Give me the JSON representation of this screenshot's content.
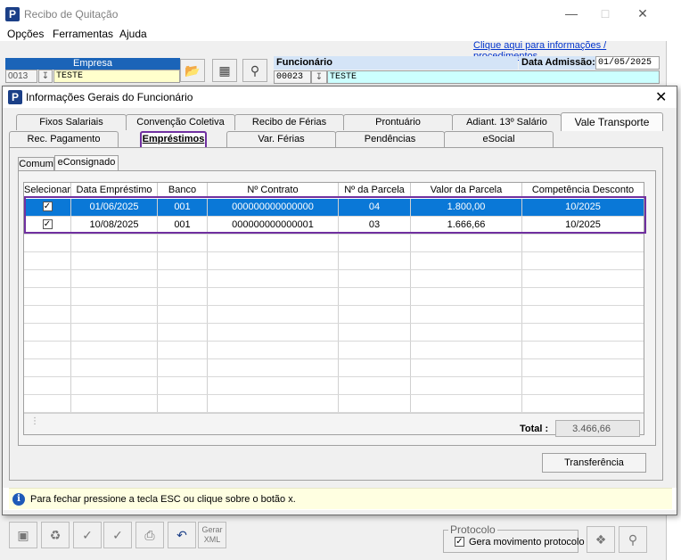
{
  "main_window": {
    "title": "Recibo de Quitação",
    "menu": [
      "Opções",
      "Ferramentas",
      "Ajuda"
    ],
    "info_link": "Clique aqui para informações / procedimentos",
    "empresa": {
      "label": "Empresa",
      "code": "0013",
      "name": "TESTE"
    },
    "funcionario": {
      "label": "Funcionário",
      "code": "00023",
      "name": "TESTE"
    },
    "data_admissao": {
      "label": "Data Admissão:",
      "value": "01/05/2025"
    },
    "bottom": {
      "gerar_xml": "Gerar\nXML",
      "protocolo_label": "Protocolo",
      "gera_movimento": "Gera movimento protocolo"
    }
  },
  "dialog": {
    "title": "Informações Gerais do Funcionário",
    "tabs_row1": [
      "Fixos Salariais",
      "Convenção Coletiva",
      "Recibo de Férias",
      "Prontuário",
      "Adiant. 13º Salário",
      "Vale Transporte"
    ],
    "tabs_row2": [
      "Rec. Pagamento",
      "Empréstimos",
      "Var. Férias",
      "Pendências",
      "eSocial"
    ],
    "active_tab": "Empréstimos",
    "subtabs": [
      "Comum",
      "eConsignado"
    ],
    "active_subtab": "eConsignado",
    "grid": {
      "columns": [
        "Selecionar",
        "Data Empréstimo",
        "Banco",
        "Nº Contrato",
        "Nº da Parcela",
        "Valor da Parcela",
        "Competência Desconto"
      ],
      "rows": [
        {
          "selected": true,
          "data": "01/06/2025",
          "banco": "001",
          "contrato": "000000000000000",
          "parcela": "04",
          "valor": "1.800,00",
          "competencia": "10/2025"
        },
        {
          "selected": true,
          "data": "10/08/2025",
          "banco": "001",
          "contrato": "000000000000001",
          "parcela": "03",
          "valor": "1.666,66",
          "competencia": "10/2025"
        }
      ]
    },
    "total_label": "Total :",
    "total_value": "3.466,66",
    "transfer_button": "Transferência",
    "info_message": "Para fechar pressione a tecla ESC ou clique sobre o botão x.",
    "colors": {
      "selection": "#0a78d7",
      "highlight": "#7030a0",
      "header_blue": "#1b64b8"
    }
  }
}
